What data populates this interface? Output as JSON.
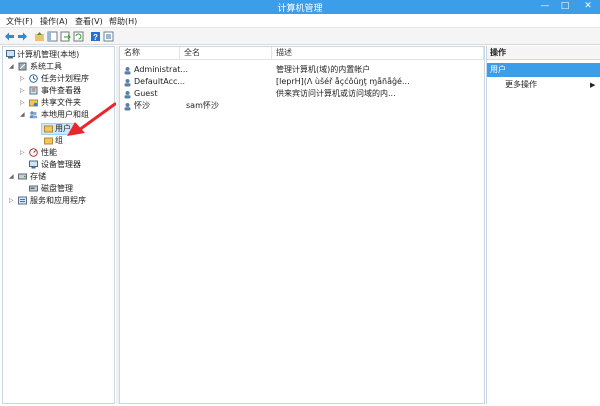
{
  "window": {
    "title": "计算机管理",
    "minimize": "—",
    "maximize": "□",
    "close": "✕"
  },
  "menu": [
    {
      "label": "文件(F)"
    },
    {
      "label": "操作(A)"
    },
    {
      "label": "查看(V)"
    },
    {
      "label": "帮助(H)"
    }
  ],
  "toolbar": {
    "icons": [
      "back-arrow-icon",
      "forward-arrow-icon",
      "up-folder-icon",
      "show-tree-icon",
      "export-icon",
      "refresh-icon",
      "help-icon",
      "properties-icon"
    ]
  },
  "tree": [
    {
      "label": "计算机管理(本地)",
      "expander": "",
      "icon": "computer-management-icon"
    },
    {
      "label": "系统工具",
      "expander": "◢",
      "icon": "tools-icon"
    },
    {
      "label": "任务计划程序",
      "expander": "▷",
      "icon": "clock-icon"
    },
    {
      "label": "事件查看器",
      "expander": "▷",
      "icon": "event-viewer-icon"
    },
    {
      "label": "共享文件夹",
      "expander": "▷",
      "icon": "shared-folder-icon"
    },
    {
      "label": "本地用户和组",
      "expander": "◢",
      "icon": "users-group-icon"
    },
    {
      "label": "用户",
      "expander": "",
      "icon": "folder-icon"
    },
    {
      "label": "组",
      "expander": "",
      "icon": "folder-icon"
    },
    {
      "label": "性能",
      "expander": "▷",
      "icon": "performance-icon"
    },
    {
      "label": "设备管理器",
      "expander": "",
      "icon": "device-manager-icon"
    },
    {
      "label": "存储",
      "expander": "◢",
      "icon": "storage-icon"
    },
    {
      "label": "磁盘管理",
      "expander": "",
      "icon": "disk-icon"
    },
    {
      "label": "服务和应用程序",
      "expander": "▷",
      "icon": "services-icon"
    }
  ],
  "columns": {
    "name": "名称",
    "fullname": "全名",
    "description": "描述"
  },
  "rows": [
    {
      "name": "Administrat...",
      "fullname": "",
      "description": "管理计算机(域)的内置帐户"
    },
    {
      "name": "DefaultAcc...",
      "fullname": "",
      "description": "[leprH](Λ ùšéř åçćôûŋţ ɱåñåĝé..."
    },
    {
      "name": "Guest",
      "fullname": "",
      "description": "供来宾访问计算机或访问域的内..."
    },
    {
      "name": "怀沙",
      "fullname": "sam怀沙",
      "description": ""
    }
  ],
  "actions": {
    "header": "操作",
    "section": "用户",
    "item": "更多操作",
    "arrow": "▶"
  },
  "colors": {
    "accent": "#3c9de9",
    "selection": "#cce8ff",
    "annotation_arrow": "#e8262d"
  }
}
